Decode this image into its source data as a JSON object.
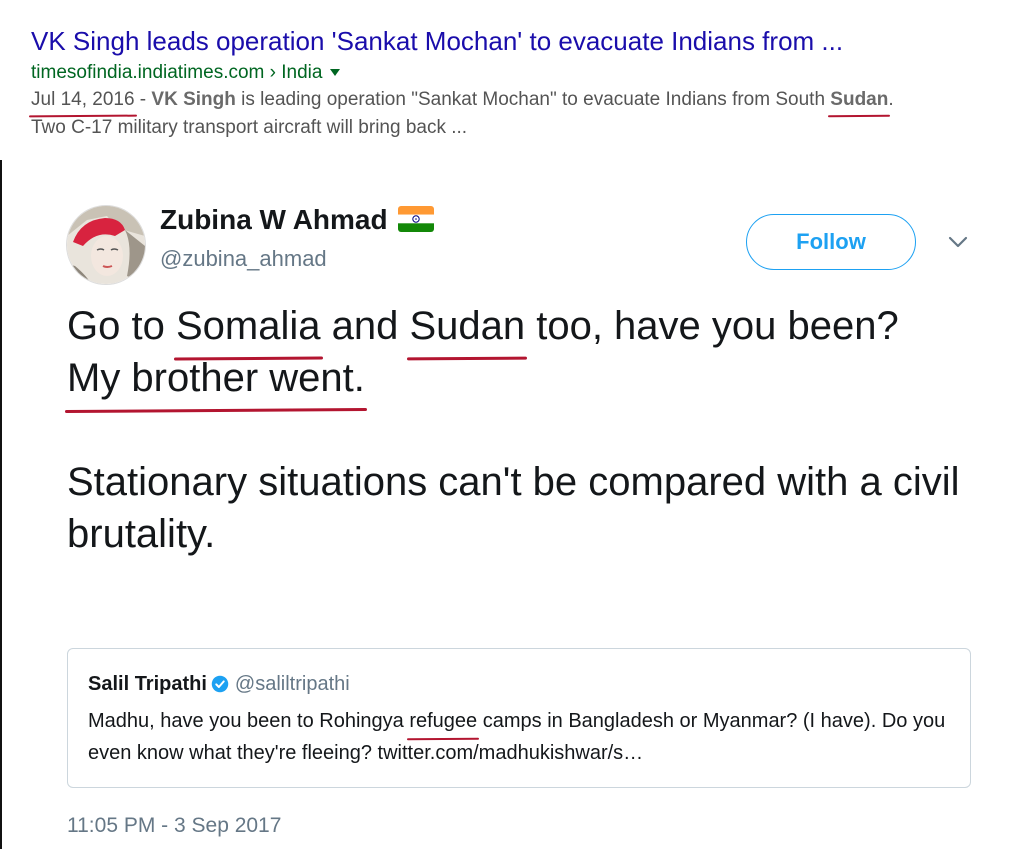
{
  "search_result": {
    "title": "VK Singh leads operation 'Sankat Mochan' to evacuate Indians from ...",
    "url": "timesofindia.indiatimes.com › India",
    "date": "Jul 14, 2016",
    "snippet_sep": " - ",
    "snippet_bold1": "VK Singh",
    "snippet_mid": " is leading operation \"Sankat Mochan\" to evacuate Indians from South ",
    "snippet_bold2": "Sudan",
    "snippet_end": ".",
    "snippet_line2": "Two C-17 military transport aircraft will bring back ..."
  },
  "tweet": {
    "display_name": "Zubina W Ahmad",
    "flag_icon": "india-flag-icon",
    "handle": "@zubina_ahmad",
    "follow_label": "Follow",
    "text": {
      "l1_a": "Go to ",
      "l1_b": "Somalia",
      "l1_c": " and ",
      "l1_d": "Sudan",
      "l1_e": " too, have you been?",
      "l2": "My brother went.",
      "l3": "Stationary situations can't be compared with a civil brutality."
    },
    "quote": {
      "name": "Salil Tripathi",
      "handle": "@saliltripathi",
      "text_a": "Madhu, have you been to Rohingya ",
      "text_b": "refugee",
      "text_c": " camps in Bangladesh or Myanmar? (I have). Do you even know what they're fleeing? twitter.com/madhukishwar/s…"
    },
    "timestamp": "11:05 PM - 3 Sep 2017"
  },
  "colors": {
    "link": "#1a0dab",
    "url_green": "#006621",
    "twitter_blue": "#1da1f2",
    "annotation_red": "#b31530"
  }
}
